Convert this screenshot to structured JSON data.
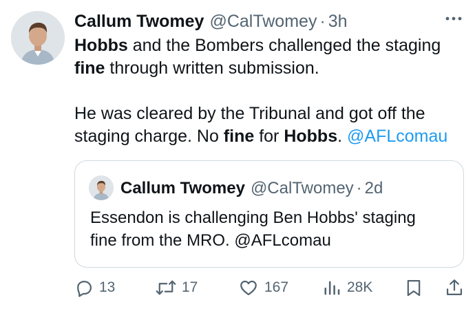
{
  "tweet": {
    "author_name": "Callum Twomey",
    "handle": "@CalTwomey",
    "separator": "·",
    "time": "3h",
    "text": {
      "line1_bold": "Hobbs",
      "line1_rest": " and the Bombers challenged the staging",
      "line2_bold": "fine",
      "line2_rest": " through written submission.",
      "line3": "He was cleared by the Tribunal and got off the",
      "line4_a": "staging charge. No ",
      "line4_bold1": "fine",
      "line4_b": " for ",
      "line4_bold2": "Hobbs",
      "line4_c": ". ",
      "mention": "@AFLcomau"
    }
  },
  "quoted_tweet": {
    "author_name": "Callum Twomey",
    "handle": "@CalTwomey",
    "separator": "·",
    "time": "2d",
    "line1": "Essendon is challenging Ben Hobbs' staging",
    "line2": "fine from the MRO. @AFLcomau"
  },
  "actions": {
    "replies": "13",
    "retweets": "17",
    "likes": "167",
    "views": "28K"
  },
  "icons": {
    "more": "more-icon",
    "reply": "reply-icon",
    "retweet": "retweet-icon",
    "like": "heart-icon",
    "views": "views-icon",
    "bookmark": "bookmark-icon",
    "share": "share-icon"
  },
  "colors": {
    "text": "#0f1419",
    "muted": "#536471",
    "link": "#1d9bf0",
    "border": "#cfd9de"
  }
}
